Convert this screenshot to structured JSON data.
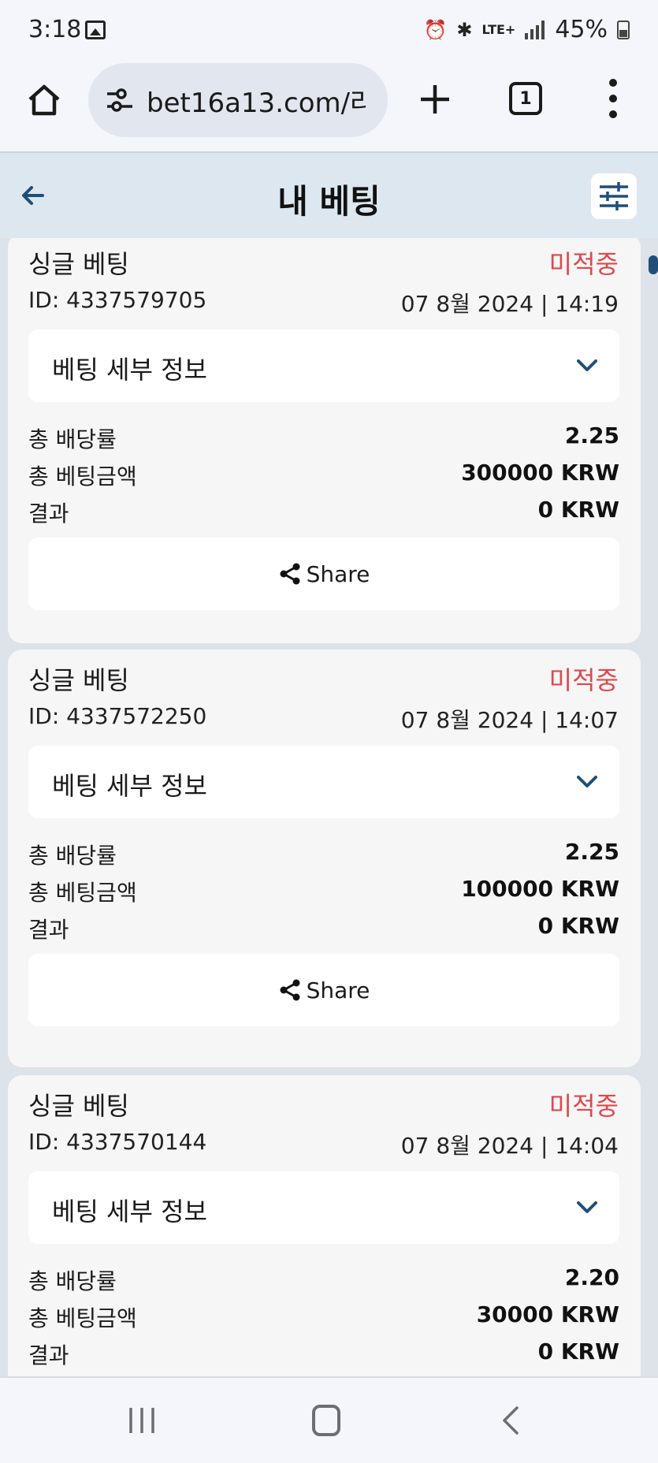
{
  "status_bar": {
    "time": "3:18",
    "signal_label": "LTE+",
    "battery": "45%"
  },
  "browser": {
    "url": "bet16a13.com/라",
    "tab_count": "1"
  },
  "header": {
    "title": "내 베팅"
  },
  "bets": [
    {
      "type": "싱글 베팅",
      "status": "미적중",
      "id": "ID: 4337579705",
      "datetime": "07 8월 2024 | 14:19",
      "details_label": "베팅 세부 정보",
      "odds_label": "총 배당률",
      "odds": "2.25",
      "stake_label": "총 베팅금액",
      "stake": "300000 KRW",
      "result_label": "결과",
      "result": "0 KRW",
      "share_label": "Share"
    },
    {
      "type": "싱글 베팅",
      "status": "미적중",
      "id": "ID: 4337572250",
      "datetime": "07 8월 2024 | 14:07",
      "details_label": "베팅 세부 정보",
      "odds_label": "총 배당률",
      "odds": "2.25",
      "stake_label": "총 베팅금액",
      "stake": "100000 KRW",
      "result_label": "결과",
      "result": "0 KRW",
      "share_label": "Share"
    },
    {
      "type": "싱글 베팅",
      "status": "미적중",
      "id": "ID: 4337570144",
      "datetime": "07 8월 2024 | 14:04",
      "details_label": "베팅 세부 정보",
      "odds_label": "총 배당률",
      "odds": "2.20",
      "stake_label": "총 베팅금액",
      "stake": "30000 KRW",
      "result_label": "결과",
      "result": "0 KRW",
      "share_label": "Share"
    }
  ],
  "colors": {
    "status_lost": "#e0474c",
    "accent": "#1f4e79",
    "header_bg": "#dde7f0"
  }
}
